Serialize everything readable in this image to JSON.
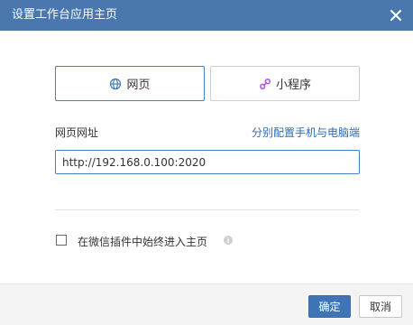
{
  "dialog": {
    "title": "设置工作台应用主页",
    "close_icon": "close-icon"
  },
  "type_options": [
    {
      "label": "网页",
      "icon": "globe-icon",
      "selected": true
    },
    {
      "label": "小程序",
      "icon": "link-icon",
      "selected": false
    }
  ],
  "url_field": {
    "label": "网页网址",
    "config_link": "分别配置手机与电脑端",
    "value": "http://192.168.0.100:2020"
  },
  "option": {
    "label": "在微信插件中始终进入主页",
    "checked": false,
    "info_icon": "info-icon"
  },
  "footer": {
    "ok_label": "确定",
    "cancel_label": "取消"
  },
  "colors": {
    "titlebar": "#4a78ae",
    "accent": "#3f75b5",
    "link": "#2f6cb5",
    "mini_program_icon": "#b45bd6"
  }
}
